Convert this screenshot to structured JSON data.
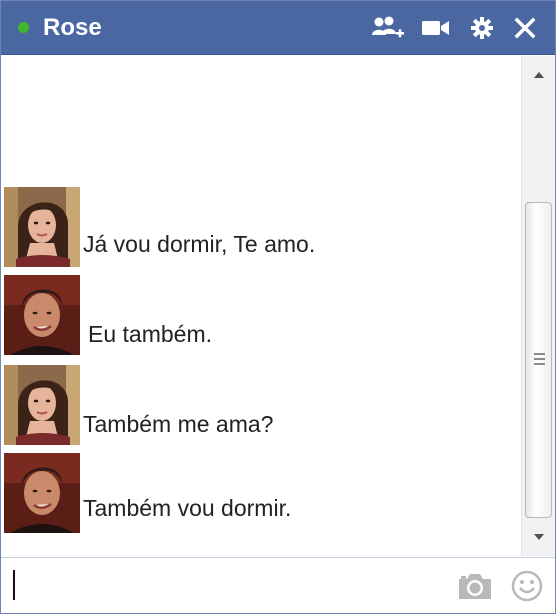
{
  "window": {
    "contact_name": "Rose",
    "online_status": "online",
    "accent_color": "#4b67a1",
    "status_color": "#42b72a"
  },
  "titlebar": {
    "icons": [
      "add-friend-icon",
      "video-call-icon",
      "settings-gear-icon",
      "close-icon"
    ]
  },
  "messages": [
    {
      "sender_avatar": "woman-avatar",
      "text": "Já vou dormir, Te amo."
    },
    {
      "sender_avatar": "man-avatar",
      "text": "Eu também."
    },
    {
      "sender_avatar": "woman-avatar",
      "text": "Também me ama?"
    },
    {
      "sender_avatar": "man-avatar",
      "text": "Também vou dormir."
    }
  ],
  "composer": {
    "value": "",
    "icons": [
      "camera-icon",
      "emoji-icon"
    ]
  }
}
